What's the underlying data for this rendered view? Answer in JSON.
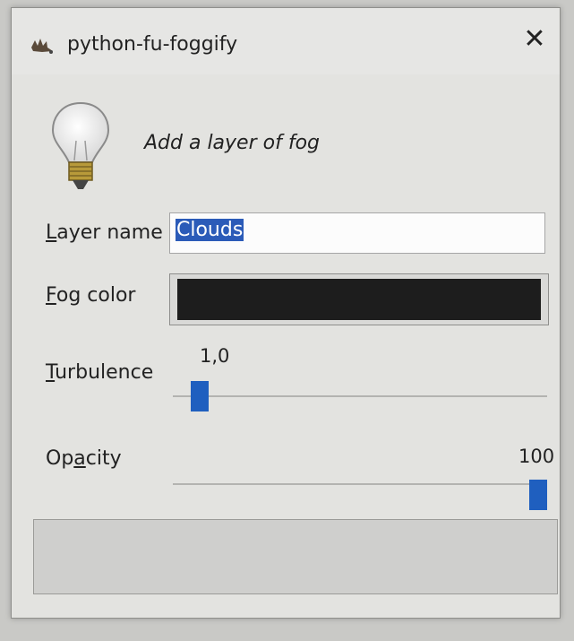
{
  "window": {
    "title": "python-fu-foggify",
    "icon": "gimp-wilber-icon",
    "close": "close-icon"
  },
  "header": {
    "icon": "lightbulb-icon",
    "description": "Add a layer of fog"
  },
  "fields": {
    "layer_name": {
      "label_mnemonic": "L",
      "label_rest": "ayer name",
      "value": "Clouds"
    },
    "fog_color": {
      "label_mnemonic": "F",
      "label_rest": "og color",
      "color": "#1d1d1d"
    },
    "turbulence": {
      "label_mnemonic": "T",
      "label_rest": "urbulence",
      "value_text": "1,0",
      "level": 0.05
    },
    "opacity": {
      "label_pre": "Op",
      "label_mnemonic": "a",
      "label_rest": "city",
      "value_text": "100",
      "level": 1.0
    }
  },
  "progress": {
    "level": 0
  },
  "colors": {
    "accent": "#1f5fbf",
    "selection": "#2b5bb8",
    "window_bg": "#e3e3e0"
  }
}
